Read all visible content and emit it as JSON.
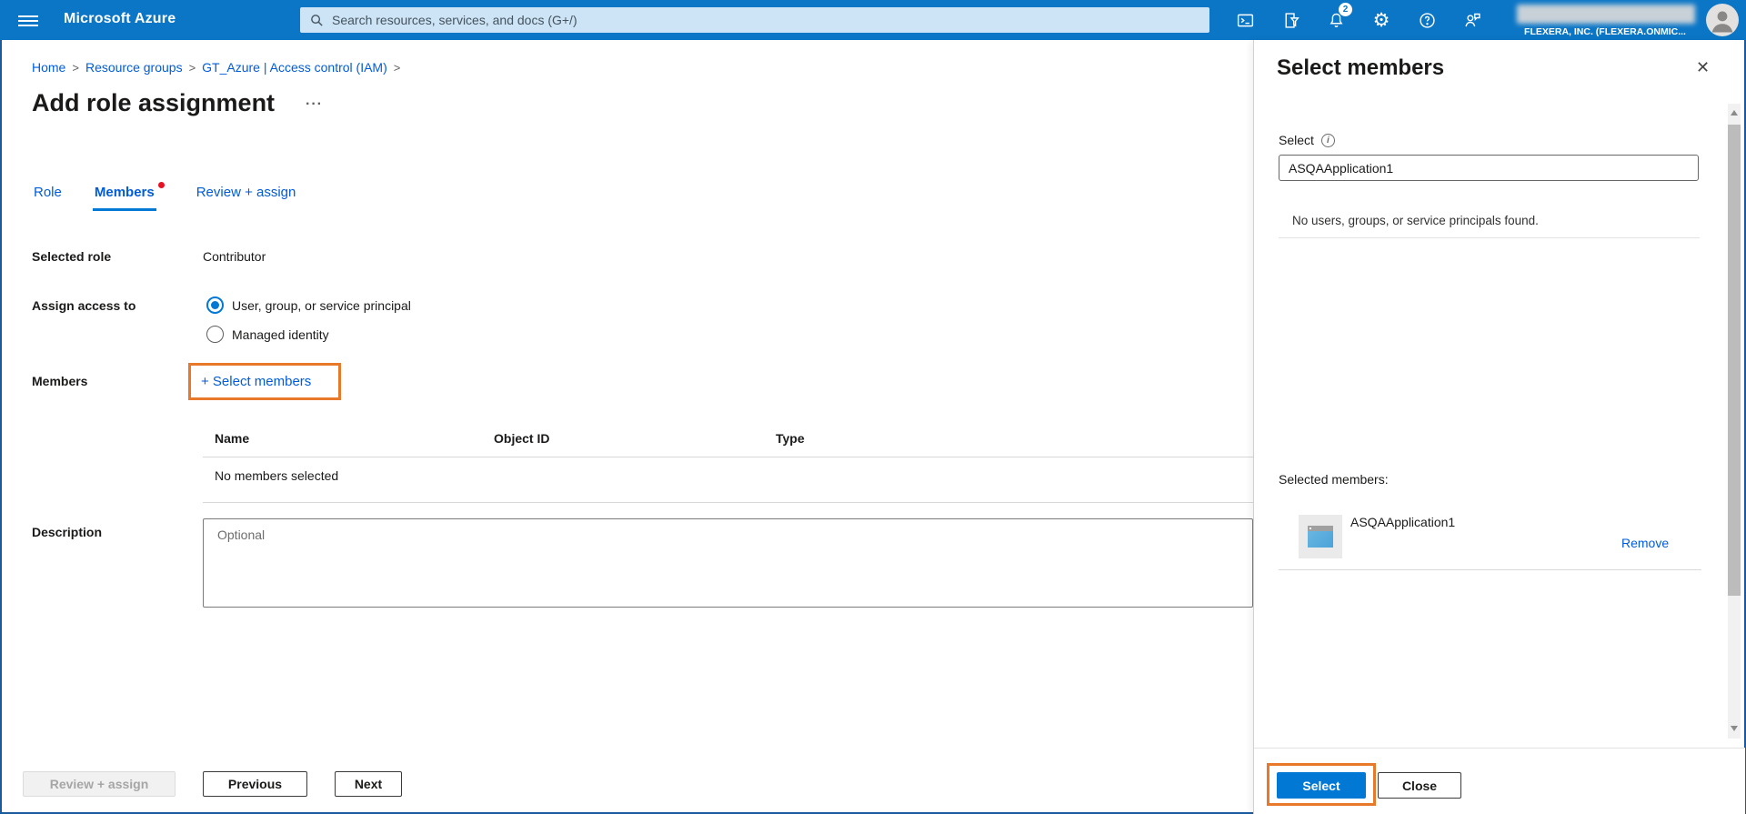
{
  "topbar": {
    "brand": "Microsoft Azure",
    "search_placeholder": "Search resources, services, and docs (G+/)",
    "notification_count": "2",
    "tenant_line": "FLEXERA, INC. (FLEXERA.ONMIC...",
    "icons": {
      "menu": "hamburger",
      "search": "magnifier",
      "cloud_shell": "terminal-prompt",
      "directory_filter": "page-funnel",
      "notifications": "bell",
      "settings": "gear",
      "help": "question-circle",
      "feedback": "person-chat",
      "avatar": "person-circle"
    }
  },
  "breadcrumb": {
    "separator": ">",
    "items": [
      "Home",
      "Resource groups",
      "GT_Azure | Access control (IAM)"
    ]
  },
  "page": {
    "title": "Add role assignment",
    "more_button": "···"
  },
  "tabs": {
    "items": [
      {
        "label": "Role",
        "active": false,
        "dot": false
      },
      {
        "label": "Members",
        "active": true,
        "dot": true
      },
      {
        "label": "Review + assign",
        "active": false,
        "dot": false
      }
    ]
  },
  "form": {
    "selected_role": {
      "label": "Selected role",
      "value": "Contributor"
    },
    "assign_access_to": {
      "label": "Assign access to",
      "options": [
        {
          "label": "User, group, or service principal",
          "selected": true
        },
        {
          "label": "Managed identity",
          "selected": false
        }
      ]
    },
    "members": {
      "label": "Members",
      "select_members_label": "+ Select members",
      "table": {
        "columns": [
          "Name",
          "Object ID",
          "Type"
        ],
        "empty_text": "No members selected"
      }
    },
    "description": {
      "label": "Description",
      "placeholder": "Optional"
    }
  },
  "main_footer": {
    "review_assign_label": "Review + assign",
    "previous_label": "Previous",
    "next_label": "Next"
  },
  "panel": {
    "title": "Select members",
    "close_glyph": "✕",
    "select_label": "Select",
    "info_glyph": "i",
    "search_value": "ASQAApplication1",
    "empty_result_text": "No users, groups, or service principals found.",
    "selected_members_label": "Selected members:",
    "members": [
      {
        "name": "ASQAApplication1",
        "icon": "app-window",
        "remove_label": "Remove"
      }
    ],
    "footer": {
      "select_label": "Select",
      "close_label": "Close"
    }
  },
  "colors": {
    "topbar_blue": "#0b76c6",
    "accent_blue": "#0078d4",
    "link_blue": "#015cda",
    "annotation_orange": "#e8792b",
    "tab_alert_red": "#e81123",
    "disabled_grey": "#f1f1f1"
  }
}
